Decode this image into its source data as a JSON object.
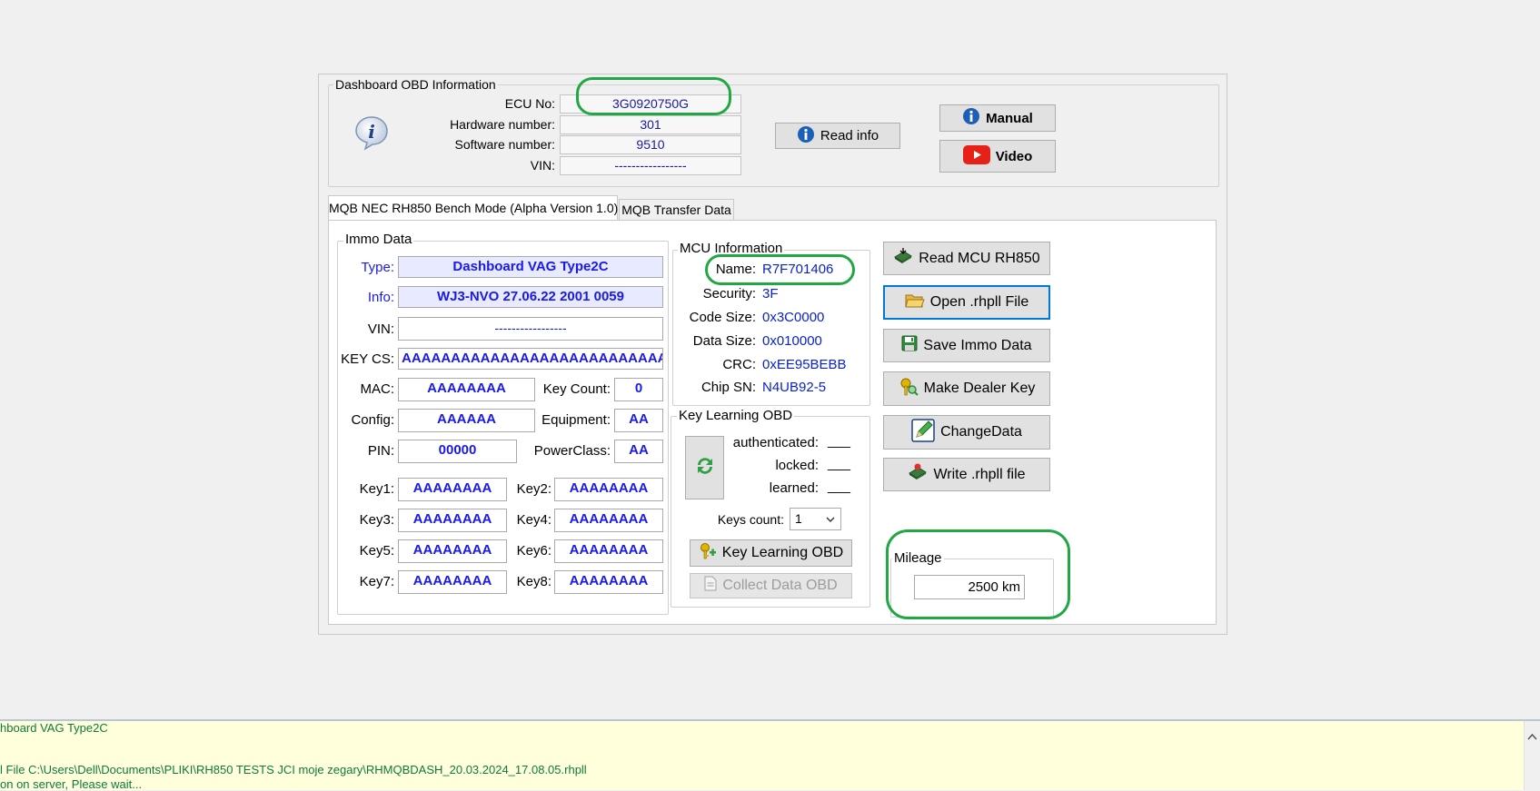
{
  "obd_group": {
    "title": "Dashboard OBD Information",
    "ecu_label": "ECU No:",
    "ecu_value": "3G0920750G",
    "hw_label": "Hardware number:",
    "hw_value": "301",
    "sw_label": "Software number:",
    "sw_value": "9510",
    "vin_label": "VIN:",
    "vin_value": "-----------------"
  },
  "buttons_top": {
    "read_info": "Read info",
    "manual": "Manual",
    "video": "Video"
  },
  "tabs": [
    {
      "label": "MQB NEC RH850 Bench Mode (Alpha Version 1.0)",
      "active": true
    },
    {
      "label": "MQB Transfer Data",
      "active": false
    }
  ],
  "immo": {
    "title": "Immo Data",
    "type_label": "Type:",
    "type_value": "Dashboard VAG Type2C",
    "info_label": "Info:",
    "info_value": "WJ3-NVO 27.06.22 2001 0059",
    "vin_label": "VIN:",
    "vin_value": "-----------------",
    "keycs_label": "KEY CS:",
    "keycs_value": "AAAAAAAAAAAAAAAAAAAAAAAAAAAAAA",
    "mac_label": "MAC:",
    "mac_value": "AAAAAAAA",
    "keycount_label": "Key Count:",
    "keycount_value": "0",
    "config_label": "Config:",
    "config_value": "AAAAAA",
    "equipment_label": "Equipment:",
    "equipment_value": "AA",
    "pin_label": "PIN:",
    "pin_value": "00000",
    "powerclass_label": "PowerClass:",
    "powerclass_value": "AA",
    "keys": [
      {
        "label": "Key1:",
        "value": "AAAAAAAA"
      },
      {
        "label": "Key2:",
        "value": "AAAAAAAA"
      },
      {
        "label": "Key3:",
        "value": "AAAAAAAA"
      },
      {
        "label": "Key4:",
        "value": "AAAAAAAA"
      },
      {
        "label": "Key5:",
        "value": "AAAAAAAA"
      },
      {
        "label": "Key6:",
        "value": "AAAAAAAA"
      },
      {
        "label": "Key7:",
        "value": "AAAAAAAA"
      },
      {
        "label": "Key8:",
        "value": "AAAAAAAA"
      }
    ]
  },
  "mcu": {
    "title": "MCU Information",
    "name_label": "Name:",
    "name_value": "R7F701406",
    "security_label": "Security:",
    "security_value": "3F",
    "codesize_label": "Code Size:",
    "codesize_value": "0x3C0000",
    "datasize_label": "Data Size:",
    "datasize_value": "0x010000",
    "crc_label": "CRC:",
    "crc_value": "0xEE95BEBB",
    "chipsn_label": "Chip SN:",
    "chipsn_value": "N4UB92-5"
  },
  "keylearn": {
    "title": "Key Learning OBD",
    "authenticated_label": "authenticated:",
    "locked_label": "locked:",
    "learned_label": "learned:",
    "status_placeholder": "___",
    "keys_count_label": "Keys count:",
    "keys_count_value": "1",
    "key_learning_button": "Key Learning OBD",
    "collect_button": "Collect Data OBD"
  },
  "actions": {
    "read_mcu": "Read MCU RH850",
    "open_file": "Open .rhpll File",
    "save_immo": "Save Immo Data",
    "make_dealer_key": "Make Dealer Key",
    "change_data": "ChangeData",
    "write_file": "Write .rhpll file"
  },
  "mileage": {
    "title": "Mileage",
    "value": "2500 km"
  },
  "log": {
    "lines": [
      "hboard VAG Type2C",
      "",
      "",
      "l File C:\\Users\\Dell\\Documents\\PLIKI\\RH850 TESTS JCI moje zegary\\RHMQBDASH_20.03.2024_17.08.05.rhpll",
      "on on server, Please wait..."
    ]
  },
  "colors": {
    "value_blue": "#0a23c8",
    "highlight_green": "#22a745",
    "log_text": "#0d7a3c",
    "log_bg": "#ffffdc"
  }
}
